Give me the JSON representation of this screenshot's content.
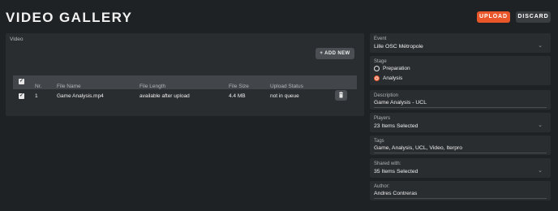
{
  "header": {
    "title": "VIDEO GALLERY",
    "upload_label": "UPLOAD",
    "discard_label": "DISCARD"
  },
  "video_section": {
    "label": "Video",
    "add_new_label": "ADD NEW",
    "columns": [
      "Nr.",
      "File Name",
      "File Length",
      "File Size",
      "Upload Status"
    ],
    "rows": [
      {
        "nr": "1",
        "file_name": "Game Analysis.mp4",
        "file_length": "available after upload",
        "file_size": "4.4 MB",
        "upload_status": "not in queue"
      }
    ]
  },
  "form": {
    "event": {
      "label": "Event",
      "value": "Lille OSC Métropole"
    },
    "stage": {
      "label": "Stage",
      "options": [
        "Preparation",
        "Analysis"
      ],
      "selected": "Analysis"
    },
    "description": {
      "label": "Description",
      "value": "Game Analysis - UCL"
    },
    "players": {
      "label": "Players",
      "value": "23 Items Selected"
    },
    "tags": {
      "label": "Tags",
      "value": "Game, Analysis, UCL, Video, Iterpro"
    },
    "shared_with": {
      "label": "Shared with:",
      "value": "35 Items Selected"
    },
    "author": {
      "label": "Author:",
      "value": "Andres Contreras"
    }
  },
  "colors": {
    "accent": "#e8562a",
    "background": "#1f2224",
    "panel": "#2a2d30"
  },
  "icons": [
    "plus-icon",
    "trash-icon",
    "chevron-down-icon",
    "check-icon"
  ]
}
